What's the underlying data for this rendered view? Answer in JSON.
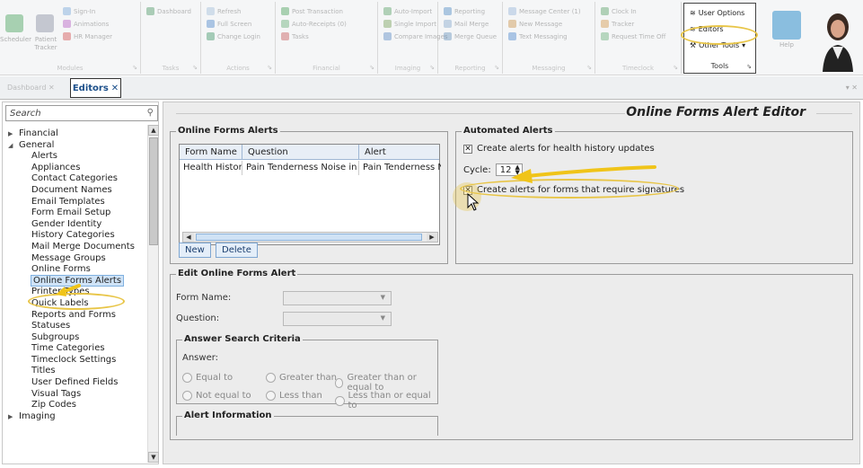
{
  "ribbon": {
    "groups": [
      {
        "label": "Modules",
        "items": [
          "Sign-In",
          "Animations",
          "HR Manager"
        ],
        "big": [
          "Scheduler",
          "Patient Tracker"
        ]
      },
      {
        "label": "Tasks",
        "items": [
          "Dashboard"
        ]
      },
      {
        "label": "Actions",
        "items": [
          "Refresh",
          "Full Screen",
          "Change Login"
        ]
      },
      {
        "label": "Financial",
        "items": [
          "Post Transaction",
          "Auto-Receipts (0)",
          "Tasks"
        ]
      },
      {
        "label": "Imaging",
        "items": [
          "Auto-Import",
          "Single Import",
          "Compare Images"
        ]
      },
      {
        "label": "Reporting",
        "items": [
          "Reporting",
          "Mail Merge",
          "Merge Queue"
        ]
      },
      {
        "label": "Messaging",
        "items": [
          "Message Center (1)",
          "New Message",
          "Text Messaging"
        ]
      },
      {
        "label": "Timeclock",
        "items": [
          "Clock In",
          "Tracker",
          "Request Time Off"
        ]
      }
    ],
    "tools": {
      "label": "Tools",
      "items": [
        "User Options",
        "Editors",
        "Other Tools"
      ]
    },
    "help": {
      "label": "Help"
    }
  },
  "tabs": {
    "dashboard": "Dashboard",
    "active": "Editors"
  },
  "sidebar": {
    "search_placeholder": "Search",
    "tree": [
      {
        "label": "Financial",
        "level": 0,
        "expander": "▶"
      },
      {
        "label": "General",
        "level": 0,
        "expander": "◢"
      },
      {
        "label": "Alerts",
        "level": 1
      },
      {
        "label": "Appliances",
        "level": 1
      },
      {
        "label": "Contact Categories",
        "level": 1
      },
      {
        "label": "Document Names",
        "level": 1
      },
      {
        "label": "Email Templates",
        "level": 1
      },
      {
        "label": "Form Email Setup",
        "level": 1
      },
      {
        "label": "Gender Identity",
        "level": 1
      },
      {
        "label": "History Categories",
        "level": 1
      },
      {
        "label": "Mail Merge Documents",
        "level": 1
      },
      {
        "label": "Message Groups",
        "level": 1
      },
      {
        "label": "Online Forms",
        "level": 1
      },
      {
        "label": "Online Forms Alerts",
        "level": 1,
        "selected": true
      },
      {
        "label": "Printer Types",
        "level": 1
      },
      {
        "label": "Quick Labels",
        "level": 1
      },
      {
        "label": "Reports and Forms",
        "level": 1
      },
      {
        "label": "Statuses",
        "level": 1
      },
      {
        "label": "Subgroups",
        "level": 1
      },
      {
        "label": "Time Categories",
        "level": 1
      },
      {
        "label": "Timeclock Settings",
        "level": 1
      },
      {
        "label": "Titles",
        "level": 1
      },
      {
        "label": "User Defined Fields",
        "level": 1
      },
      {
        "label": "Visual Tags",
        "level": 1
      },
      {
        "label": "Zip Codes",
        "level": 1
      },
      {
        "label": "Imaging",
        "level": 0,
        "expander": "▶"
      }
    ]
  },
  "main": {
    "title": "Online Forms Alert Editor",
    "online_forms_alerts": {
      "legend": "Online Forms Alerts",
      "columns": [
        "Form Name",
        "Question",
        "Alert"
      ],
      "rows": [
        [
          "Health History",
          "Pain Tenderness Noise in Jaw",
          "Pain Tenderness Noise"
        ]
      ],
      "new_button": "New",
      "delete_button": "Delete"
    },
    "automated_alerts": {
      "legend": "Automated Alerts",
      "health_history_label": "Create alerts for health history updates",
      "health_history_checked": true,
      "cycle_label": "Cycle:",
      "cycle_value": "12",
      "signatures_label": "Create alerts for forms that require signatures",
      "signatures_checked": true
    },
    "edit": {
      "legend": "Edit Online Forms Alert",
      "form_name_label": "Form Name:",
      "question_label": "Question:",
      "criteria_legend": "Answer Search Criteria",
      "answer_label": "Answer:",
      "radios": [
        "Equal to",
        "Greater than",
        "Greater than or equal to",
        "Not equal to",
        "Less than",
        "Less than or equal to"
      ],
      "alert_info_legend": "Alert Information"
    }
  },
  "colors": {
    "highlight": "#e8c547",
    "accent": "#1b4f8a",
    "selection": "#cfe3f7"
  }
}
